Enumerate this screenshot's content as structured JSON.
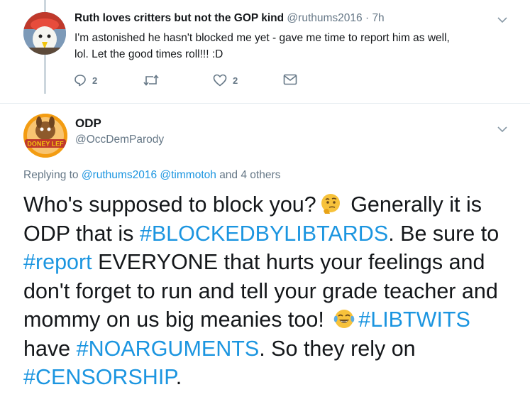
{
  "reply_tweet": {
    "display_name": "Ruth loves critters but not the GOP kind",
    "handle": "@ruthums2016",
    "separator": "·",
    "time": "7h",
    "text_line1": "I'm astonished he hasn't blocked me yet - gave me time to report him as well,",
    "text_line2": "lol. Let the good times roll!!! :D",
    "reply_count": "2",
    "like_count": "2",
    "icons": [
      "reply-icon",
      "retweet-icon",
      "like-icon",
      "message-icon",
      "chevron-down-icon"
    ]
  },
  "main_tweet": {
    "display_name": "ODP",
    "handle": "@OccDemParody",
    "avatar_text": "DONEY LEF",
    "replying_prefix": "Replying to",
    "replying_user1": "@ruthums2016",
    "replying_user2": "@timmotoh",
    "replying_suffix": "and 4 others",
    "text": {
      "p1": "Who's supposed to block you?",
      "p2": " Generally it is ODP that is ",
      "tag1": "#BLOCKEDBYLIBTARDS",
      "p3": ". Be sure to ",
      "tag2": "#report",
      "p4": " EVERYONE that hurts your feelings and don't forget to run and tell your grade teacher and mommy on us big meanies too! ",
      "tag3": "#LIBTWITS",
      "p5": " have ",
      "tag4": "#NOARGUMENTS",
      "p6": ". So they rely on ",
      "tag5": "#CENSORSHIP",
      "p7": "."
    },
    "emojis": [
      "thinking-face-emoji",
      "tears-of-joy-emoji"
    ]
  },
  "colors": {
    "link": "#1b95e0",
    "secondary_text": "#657786",
    "primary_text": "#14171a",
    "thread_line": "#ccd6dd"
  }
}
